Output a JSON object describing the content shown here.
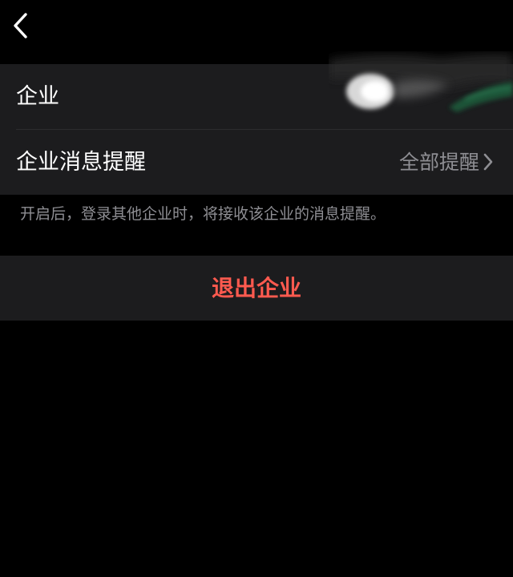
{
  "nav": {
    "back_icon": "chevron-left-icon"
  },
  "settings": {
    "enterprise": {
      "label": "企业",
      "value_redacted": true
    },
    "notification": {
      "label": "企业消息提醒",
      "value": "全部提醒",
      "chevron_icon": "chevron-right-icon"
    },
    "description": "开启后，登录其他企业时，将接收该企业的消息提醒。"
  },
  "actions": {
    "exit_label": "退出企业",
    "exit_color": "#ff5a4f"
  },
  "colors": {
    "background": "#000000",
    "cell_background": "#1c1c1e",
    "secondary_text": "#8e8e93"
  }
}
